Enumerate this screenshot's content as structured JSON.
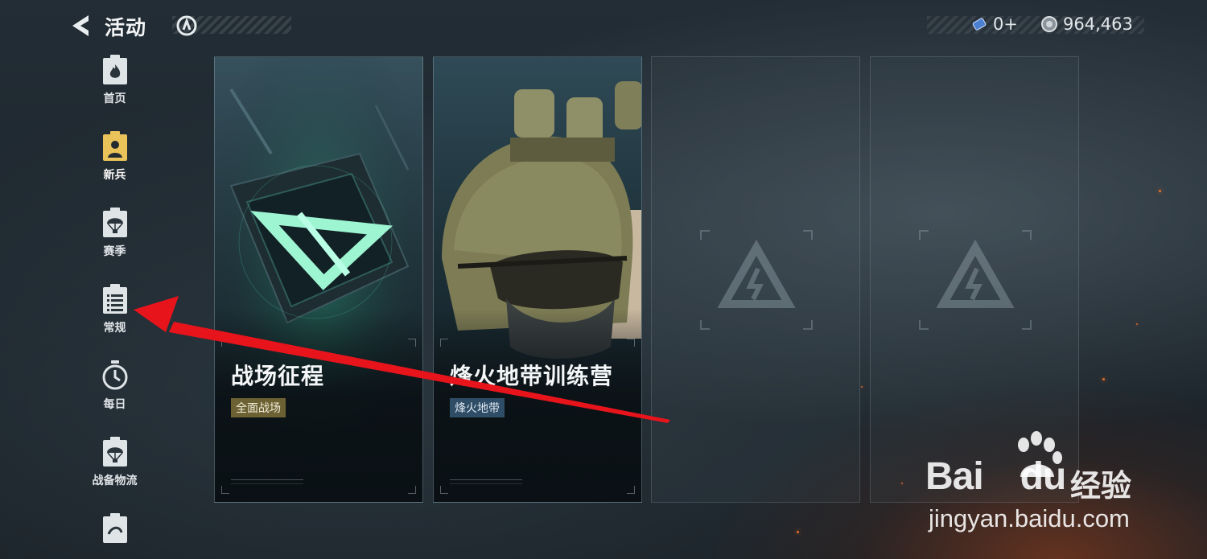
{
  "header": {
    "title": "活动",
    "back_icon": "back-arrow-icon",
    "resources": {
      "tickets": "0+",
      "coins": "964,463"
    }
  },
  "sidebar": {
    "items": [
      {
        "label": "首页",
        "icon": "home-flame-icon",
        "active": false
      },
      {
        "label": "新兵",
        "icon": "recruit-icon",
        "active": true
      },
      {
        "label": "赛季",
        "icon": "season-parachute-icon",
        "active": false
      },
      {
        "label": "常规",
        "icon": "regular-list-icon",
        "active": false
      },
      {
        "label": "每日",
        "icon": "daily-clock-icon",
        "active": false
      },
      {
        "label": "战备物流",
        "icon": "logistics-parachute-icon",
        "active": false
      },
      {
        "label": "",
        "icon": "more-icon",
        "active": false
      }
    ]
  },
  "cards": [
    {
      "title": "战场征程",
      "tag": "全面战场",
      "tag_style": "gold"
    },
    {
      "title": "烽火地带训练营",
      "tag": "烽火地带",
      "tag_style": "blue"
    }
  ],
  "watermark": {
    "brand": "Bai",
    "brand_end": "du",
    "cn": "经验",
    "url": "jingyan.baidu.com"
  },
  "colors": {
    "active_icon_bg": "#e9c25a",
    "annotation_arrow": "#e8141c",
    "tag_gold": "#6c6133",
    "tag_blue": "#2f4d66"
  }
}
